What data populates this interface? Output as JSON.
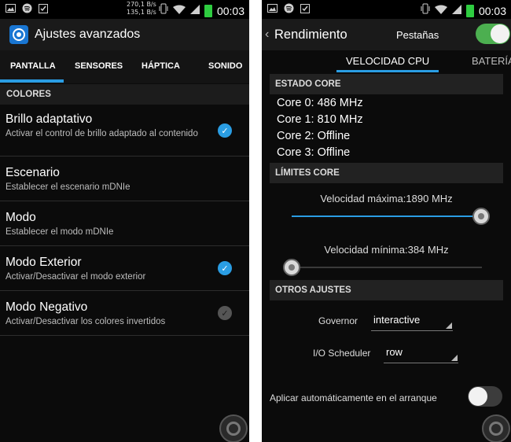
{
  "left": {
    "status": {
      "speed_up": "270,1 B/s",
      "speed_down": "135,1 B/s",
      "time": "00:03"
    },
    "app_title": "Ajustes avanzados",
    "tabs": [
      "PANTALLA",
      "SENSORES",
      "HÁPTICA",
      "SONIDO"
    ],
    "section": "COLORES",
    "items": [
      {
        "title": "Brillo adaptativo",
        "subtitle": "Activar el control de brillo adaptado al contenido",
        "checked": true
      },
      {
        "title": "Escenario",
        "subtitle": "Establecer el escenario mDNIe"
      },
      {
        "title": "Modo",
        "subtitle": "Establecer el modo mDNIe"
      },
      {
        "title": "Modo Exterior",
        "subtitle": "Activar/Desactivar el modo exterior",
        "checked": true
      },
      {
        "title": "Modo Negativo",
        "subtitle": "Activar/Desactivar los colores invertidos",
        "checked": false
      }
    ]
  },
  "right": {
    "status": {
      "time": "00:03"
    },
    "back_glyph": "‹",
    "title": "Rendimiento",
    "tabs_label": "Pestañas",
    "tabs_toggle_on": true,
    "tabs": [
      "VELOCIDAD CPU",
      "BATERÍA"
    ],
    "sections": {
      "core_state": "ESTADO CORE",
      "limits": "LÍMITES CORE",
      "other": "OTROS AJUSTES"
    },
    "cores": [
      "Core 0: 486 MHz",
      "Core 1: 810 MHz",
      "Core 2: Offline",
      "Core 3: Offline"
    ],
    "max_speed_label": "Velocidad máxima:1890 MHz",
    "max_speed_fraction": 1.0,
    "min_speed_label": "Velocidad mínima:384 MHz",
    "min_speed_fraction": 0.0,
    "governor_label": "Governor",
    "governor_value": "interactive",
    "scheduler_label": "I/O Scheduler",
    "scheduler_value": "row",
    "apply_on_boot_label": "Aplicar automáticamente en el arranque",
    "apply_on_boot": false
  },
  "colors": {
    "accent": "#2a9de3",
    "toggle_on": "#4caf50",
    "background": "#0b0b0b"
  }
}
